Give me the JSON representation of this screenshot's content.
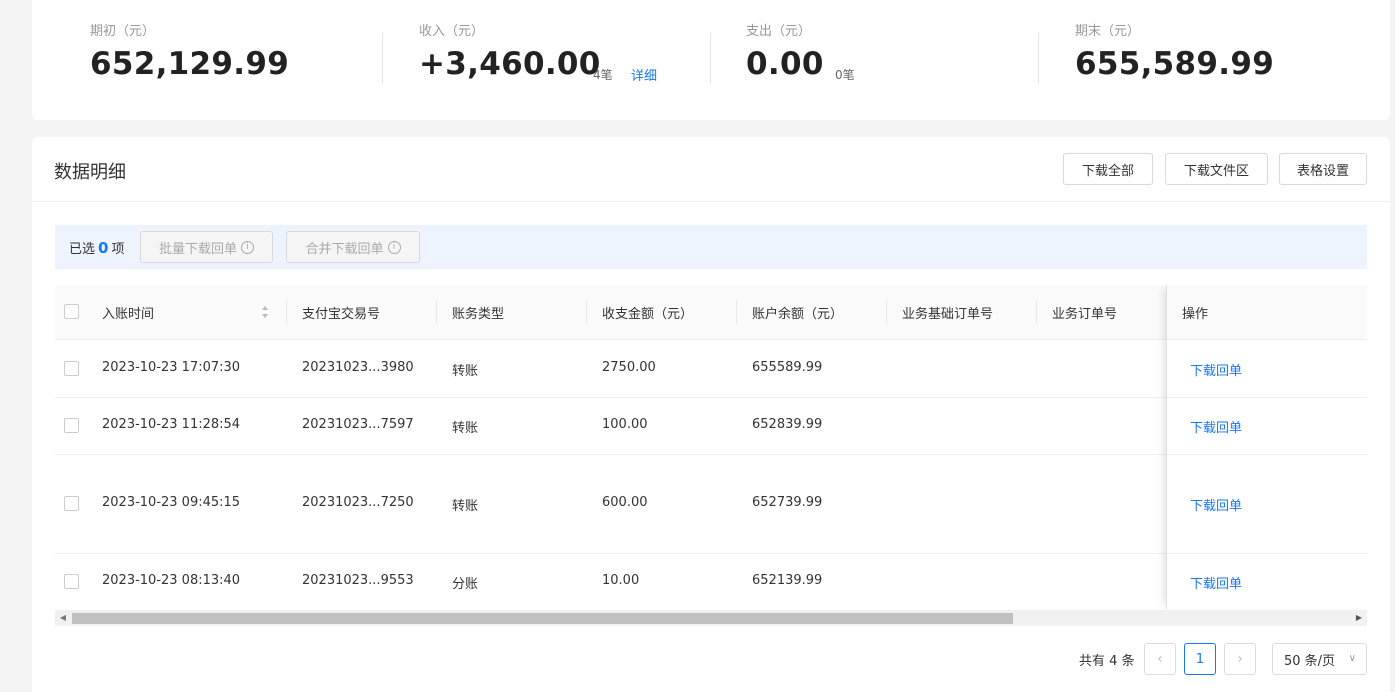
{
  "summary": {
    "opening": {
      "label": "期初（元）",
      "value": "652,129.99"
    },
    "income": {
      "label": "收入（元）",
      "value": "+3,460.00",
      "count": "4笔",
      "link": "详细"
    },
    "expense": {
      "label": "支出（元）",
      "value": "0.00",
      "count": "0笔"
    },
    "closing": {
      "label": "期末（元）",
      "value": "655,589.99"
    }
  },
  "detail": {
    "title": "数据明细",
    "buttons": {
      "download_all": "下载全部",
      "download_area": "下载文件区",
      "table_settings": "表格设置"
    }
  },
  "selection": {
    "prefix": "已选",
    "count": "0",
    "suffix": "项",
    "batch_download": "批量下载回单",
    "merge_download": "合并下载回单"
  },
  "table": {
    "columns": [
      "入账时间",
      "支付宝交易号",
      "账务类型",
      "收支金额（元）",
      "账户余额（元）",
      "业务基础订单号",
      "业务订单号",
      "操作"
    ],
    "rows": [
      {
        "time": "2023-10-23 17:07:30",
        "trade_no": "20231023...3980",
        "type": "转账",
        "amount": "2750.00",
        "balance": "655589.99",
        "base_order": "",
        "order": "",
        "action": "下载回单"
      },
      {
        "time": "2023-10-23 11:28:54",
        "trade_no": "20231023...7597",
        "type": "转账",
        "amount": "100.00",
        "balance": "652839.99",
        "base_order": "",
        "order": "",
        "action": "下载回单"
      },
      {
        "time": "2023-10-23 09:45:15",
        "trade_no": "20231023...7250",
        "type": "转账",
        "amount": "600.00",
        "balance": "652739.99",
        "base_order": "",
        "order": "",
        "action": "下载回单"
      },
      {
        "time": "2023-10-23 08:13:40",
        "trade_no": "20231023...9553",
        "type": "分账",
        "amount": "10.00",
        "balance": "652139.99",
        "base_order": "",
        "order": "",
        "action": "下载回单"
      }
    ]
  },
  "pagination": {
    "total": "共有 4 条",
    "current": "1",
    "page_size": "50 条/页"
  }
}
